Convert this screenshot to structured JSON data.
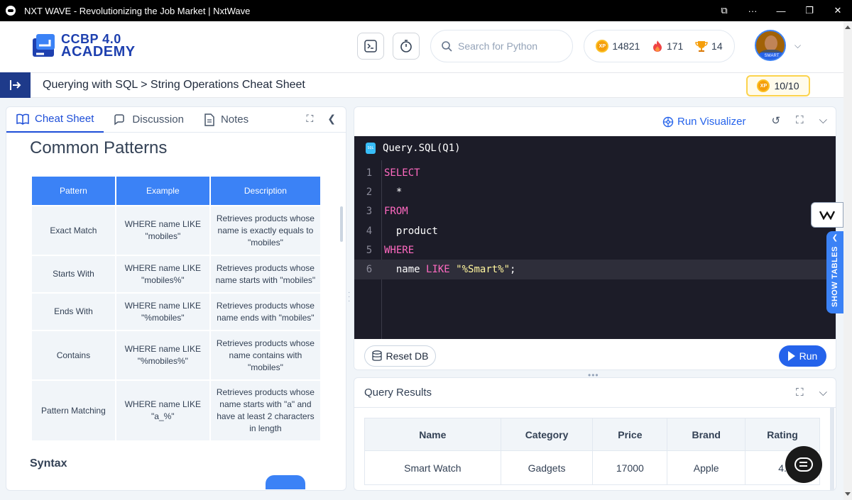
{
  "window": {
    "title": "NXT WAVE - Revolutionizing the Job Market | NxtWave",
    "controls": [
      "⧉",
      "···",
      "—",
      "⧉",
      "✕"
    ]
  },
  "header": {
    "logo_line1": "CCBP 4.0",
    "logo_line2": "ACADEMY",
    "search_placeholder": "Search for Python",
    "xp_points": "14821",
    "streak": "171",
    "trophies": "14",
    "xp_coin_label": "XP",
    "avatar_badge": "SMART"
  },
  "breadcrumb": {
    "text": "Querying with SQL > String Operations Cheat Sheet",
    "xp_score": "10/10"
  },
  "left_panel": {
    "tabs": [
      {
        "label": "Cheat Sheet",
        "active": true
      },
      {
        "label": "Discussion"
      },
      {
        "label": "Notes"
      }
    ],
    "heading": "Common Patterns",
    "table_headers": [
      "Pattern",
      "Example",
      "Description"
    ],
    "table_rows": [
      [
        "Exact Match",
        "WHERE name LIKE \"mobiles\"",
        "Retrieves products whose name is exactly equals to \"mobiles\""
      ],
      [
        "Starts With",
        "WHERE name LIKE \"mobiles%\"",
        "Retrieves products whose name starts with \"mobiles\""
      ],
      [
        "Ends With",
        "WHERE name LIKE \"%mobiles\"",
        "Retrieves products whose name ends with \"mobiles\""
      ],
      [
        "Contains",
        "WHERE name LIKE \"%mobiles%\"",
        "Retrieves products whose name contains with \"mobiles\""
      ],
      [
        "Pattern Matching",
        "WHERE name LIKE \"a_%\"",
        "Retrieves products whose name starts with \"a\" and have at least 2 characters in length"
      ]
    ],
    "syntax_heading": "Syntax"
  },
  "editor": {
    "run_visualizer": "Run Visualizer",
    "file_title": "Query.SQL(Q1)",
    "lines": [
      {
        "n": "1",
        "parts": [
          {
            "t": "SELECT",
            "c": "kw"
          }
        ]
      },
      {
        "n": "2",
        "parts": [
          {
            "t": "  *",
            "c": ""
          }
        ]
      },
      {
        "n": "3",
        "parts": [
          {
            "t": "FROM",
            "c": "kw"
          }
        ]
      },
      {
        "n": "4",
        "parts": [
          {
            "t": "  product",
            "c": ""
          }
        ]
      },
      {
        "n": "5",
        "parts": [
          {
            "t": "WHERE",
            "c": "kw"
          }
        ]
      },
      {
        "n": "6",
        "parts": [
          {
            "t": "  name ",
            "c": ""
          },
          {
            "t": "LIKE ",
            "c": "kw"
          },
          {
            "t": "\"%Smart%\"",
            "c": "str"
          },
          {
            "t": ";",
            "c": ""
          }
        ],
        "highlight": true
      }
    ],
    "reset_label": "Reset DB",
    "run_label": "Run",
    "show_tables": "SHOW TABLES"
  },
  "results": {
    "title": "Query Results",
    "headers": [
      "Name",
      "Category",
      "Price",
      "Brand",
      "Rating"
    ],
    "rows": [
      [
        "Smart Watch",
        "Gadgets",
        "17000",
        "Apple",
        "4."
      ]
    ]
  },
  "colors": {
    "brand_blue": "#1e3a8a",
    "accent": "#2563eb",
    "keyword": "#ff6ac1",
    "string": "#fff59d"
  }
}
